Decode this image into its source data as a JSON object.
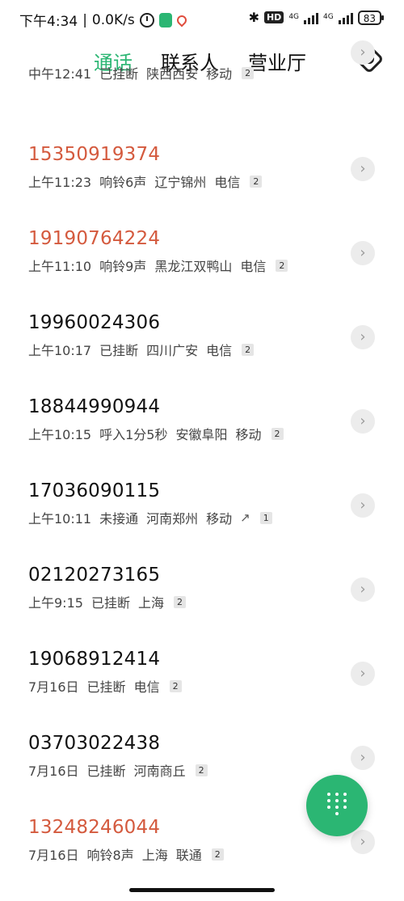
{
  "status": {
    "time": "下午4:34",
    "separator": "|",
    "speed": "0.0K/s",
    "hd": "HD",
    "net1": "4G",
    "net2": "4G",
    "battery": "83"
  },
  "tabs": [
    {
      "label": "通话",
      "active": true
    },
    {
      "label": "联系人",
      "active": false
    },
    {
      "label": "营业厅",
      "active": false
    }
  ],
  "calls": [
    {
      "number": "",
      "time": "中午12:41",
      "status": "已挂断",
      "location": "陕西西安",
      "carrier": "移动",
      "count": "2",
      "missed": false
    },
    {
      "number": "15350919374",
      "time": "上午11:23",
      "status": "响铃6声",
      "location": "辽宁锦州",
      "carrier": "电信",
      "count": "2",
      "missed": true
    },
    {
      "number": "19190764224",
      "time": "上午11:10",
      "status": "响铃9声",
      "location": "黑龙江双鸭山",
      "carrier": "电信",
      "count": "2",
      "missed": true
    },
    {
      "number": "19960024306",
      "time": "上午10:17",
      "status": "已挂断",
      "location": "四川广安",
      "carrier": "电信",
      "count": "2",
      "missed": false
    },
    {
      "number": "18844990944",
      "time": "上午10:15",
      "status": "呼入1分5秒",
      "location": "安徽阜阳",
      "carrier": "移动",
      "count": "2",
      "missed": false
    },
    {
      "number": "17036090115",
      "time": "上午10:11",
      "status": "未接通",
      "location": "河南郑州",
      "carrier": "移动",
      "count": "1",
      "missed": false,
      "outgoing": true
    },
    {
      "number": "02120273165",
      "time": "上午9:15",
      "status": "已挂断",
      "location": "上海",
      "carrier": "",
      "count": "2",
      "missed": false
    },
    {
      "number": "19068912414",
      "time": "7月16日",
      "status": "已挂断",
      "location": "电信",
      "carrier": "",
      "count": "2",
      "missed": false
    },
    {
      "number": "03703022438",
      "time": "7月16日",
      "status": "已挂断",
      "location": "河南商丘",
      "carrier": "",
      "count": "2",
      "missed": false
    },
    {
      "number": "13248246044",
      "time": "7月16日",
      "status": "响铃8声",
      "location": "上海",
      "carrier": "联通",
      "count": "2",
      "missed": true
    }
  ],
  "icons": {
    "chevron": "›",
    "outgoing_arrow": "↗"
  },
  "colors": {
    "accent": "#2bb673",
    "missed": "#d45a3e"
  }
}
